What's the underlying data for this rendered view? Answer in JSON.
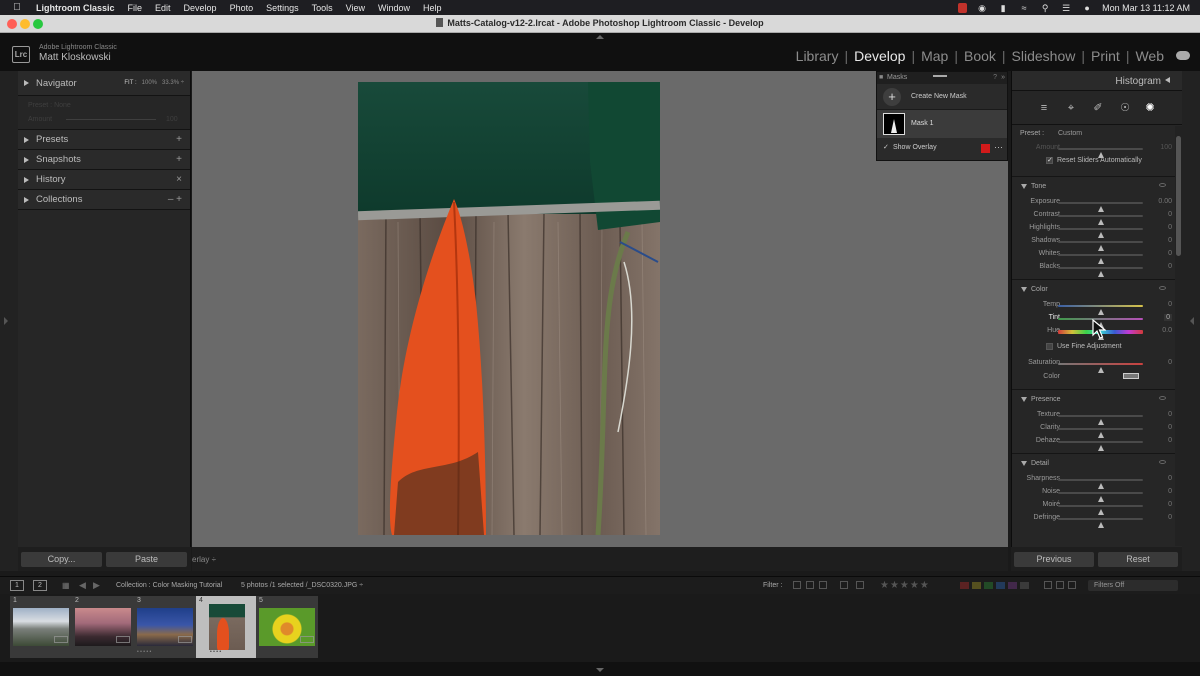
{
  "menubar": {
    "app_name": "Lightroom Classic",
    "items": [
      "File",
      "Edit",
      "Develop",
      "Photo",
      "Settings",
      "Tools",
      "View",
      "Window",
      "Help"
    ],
    "clock": "Mon Mar 13  11:12 AM"
  },
  "window": {
    "title": "Matts-Catalog-v12-2.lrcat - Adobe Photoshop Lightroom Classic - Develop"
  },
  "identity": {
    "logo": "Lrc",
    "product": "Adobe Lightroom Classic",
    "user": "Matt Kloskowski"
  },
  "modules": {
    "items": [
      "Library",
      "Develop",
      "Map",
      "Book",
      "Slideshow",
      "Print",
      "Web"
    ],
    "active": "Develop"
  },
  "left_panel": {
    "navigator": {
      "label": "Navigator",
      "zoom_fit": "FIT :",
      "zoom_100": "100%",
      "zoom_other": "33.3% ÷"
    },
    "nav_ghost": {
      "line1": "Preset : None",
      "line2": "Amount",
      "value": "100"
    },
    "sections": [
      {
        "label": "Presets",
        "control": "+"
      },
      {
        "label": "Snapshots",
        "control": "+"
      },
      {
        "label": "History",
        "control": "×"
      },
      {
        "label": "Collections",
        "control": "–  +"
      }
    ],
    "copy_label": "Copy...",
    "paste_label": "Paste"
  },
  "toolbar": {
    "overlay_label": "erlay ÷"
  },
  "mask_panel": {
    "title": "Masks",
    "create_label": "Create New Mask",
    "mask_name": "Mask 1",
    "show_overlay_label": "Show Overlay",
    "overlay_color": "#d11a1a"
  },
  "right_panel": {
    "histogram_label": "Histogram",
    "preset": {
      "key": "Preset :",
      "value": "Custom"
    },
    "amount": {
      "label": "Amount",
      "value": "100",
      "position": 0.5
    },
    "reset_sliders_label": "Reset Sliders Automatically",
    "tone": {
      "label": "Tone",
      "sliders": [
        {
          "label": "Exposure",
          "value": "0.00",
          "position": 0.5
        },
        {
          "label": "Contrast",
          "value": "0",
          "position": 0.5
        },
        {
          "label": "Highlights",
          "value": "0",
          "position": 0.5
        },
        {
          "label": "Shadows",
          "value": "0",
          "position": 0.5
        },
        {
          "label": "Whites",
          "value": "0",
          "position": 0.5
        },
        {
          "label": "Blacks",
          "value": "0",
          "position": 0.5
        }
      ]
    },
    "color": {
      "label": "Color",
      "temp": {
        "label": "Temp",
        "value": "0",
        "position": 0.5
      },
      "tint": {
        "label": "Tint",
        "value": "0",
        "position": 0.5
      },
      "hue": {
        "label": "Hue",
        "value": "0.0",
        "position": 0.5
      },
      "fine_adjustment_label": "Use Fine Adjustment",
      "saturation": {
        "label": "Saturation",
        "value": "0",
        "position": 0.5
      },
      "color_label": "Color"
    },
    "presence": {
      "label": "Presence",
      "sliders": [
        {
          "label": "Texture",
          "value": "0",
          "position": 0.5
        },
        {
          "label": "Clarity",
          "value": "0",
          "position": 0.5
        },
        {
          "label": "Dehaze",
          "value": "0",
          "position": 0.5
        }
      ]
    },
    "detail": {
      "label": "Detail",
      "sliders": [
        {
          "label": "Sharpness",
          "value": "0",
          "position": 0.5
        },
        {
          "label": "Noise",
          "value": "0",
          "position": 0.5
        },
        {
          "label": "Moiré",
          "value": "0",
          "position": 0.5
        },
        {
          "label": "Defringe",
          "value": "0",
          "position": 0.5
        }
      ]
    },
    "previous_label": "Previous",
    "reset_label": "Reset"
  },
  "filmstrip_bar": {
    "screen1": "1",
    "screen2": "2",
    "source": "Collection : Color Masking Tutorial",
    "count": "5 photos /1 selected /_DSC0320.JPG ÷",
    "filter_label": "Filter :",
    "filters_value": "Filters Off"
  },
  "filmstrip": [
    {
      "num": "1",
      "stars": ""
    },
    {
      "num": "2",
      "stars": ""
    },
    {
      "num": "3",
      "stars": "• • • • •"
    },
    {
      "num": "4",
      "stars": "• • • •"
    },
    {
      "num": "5",
      "stars": ""
    }
  ]
}
